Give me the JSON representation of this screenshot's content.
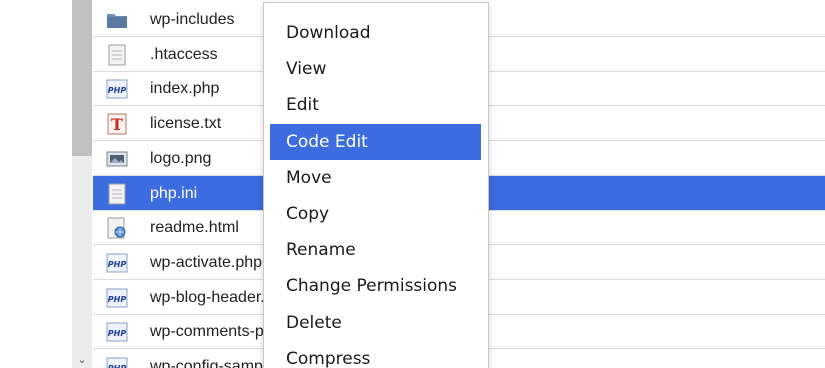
{
  "files": [
    {
      "name": "wp-includes",
      "icon": "folder-icon",
      "selected": false
    },
    {
      "name": ".htaccess",
      "icon": "text-file-icon",
      "selected": false
    },
    {
      "name": "index.php",
      "icon": "php-file-icon",
      "selected": false
    },
    {
      "name": "license.txt",
      "icon": "txt-file-icon",
      "selected": false
    },
    {
      "name": "logo.png",
      "icon": "image-file-icon",
      "selected": false
    },
    {
      "name": "php.ini",
      "icon": "text-file-icon",
      "selected": true
    },
    {
      "name": "readme.html",
      "icon": "html-file-icon",
      "selected": false
    },
    {
      "name": "wp-activate.php",
      "icon": "php-file-icon",
      "selected": false
    },
    {
      "name": "wp-blog-header.php",
      "icon": "php-file-icon",
      "selected": false
    },
    {
      "name": "wp-comments-post.php",
      "icon": "php-file-icon",
      "selected": false
    },
    {
      "name": "wp-config-sample.php",
      "icon": "php-file-icon",
      "selected": false
    }
  ],
  "icon_text": {
    "php": "PHP",
    "txt": "T"
  },
  "context_menu": {
    "items": [
      {
        "label": "Download",
        "active": false
      },
      {
        "label": "View",
        "active": false
      },
      {
        "label": "Edit",
        "active": false
      },
      {
        "label": "Code Edit",
        "active": true
      },
      {
        "label": "Move",
        "active": false
      },
      {
        "label": "Copy",
        "active": false
      },
      {
        "label": "Rename",
        "active": false
      },
      {
        "label": "Change Permissions",
        "active": false
      },
      {
        "label": "Delete",
        "active": false
      },
      {
        "label": "Compress",
        "active": false
      }
    ]
  },
  "scrollbar": {
    "down_arrow": "⌄"
  },
  "colors": {
    "selection": "#3d6be0",
    "php_icon": "#1f3f94",
    "txt_icon": "#cc2b1c",
    "folder": "#6f8fb5"
  }
}
